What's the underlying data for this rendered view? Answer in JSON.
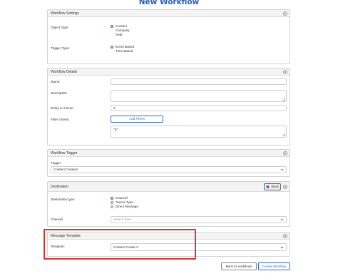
{
  "page": {
    "title": "New Workflow"
  },
  "workflow_settings": {
    "title": "Workflow Settings",
    "object_type_label": "Object Type:",
    "object_types": [
      "Contact",
      "Company",
      "Deal"
    ],
    "object_type_selected": "Contact",
    "trigger_type_label": "Trigger Type:",
    "trigger_types": [
      "Event Based",
      "Time Based"
    ],
    "trigger_type_selected": "Event Based"
  },
  "workflow_details": {
    "title": "Workflow Details",
    "name_label": "Name:",
    "name_value": "",
    "description_label": "Description",
    "description_value": "",
    "delay_label": "Delay in minute",
    "delay_value": "0",
    "filter_label": "Filter criteria",
    "add_filters_label": "Add Filters",
    "filter_value": "\"{}\""
  },
  "workflow_trigger": {
    "title": "Workflow Trigger",
    "trigger_label": "Trigger",
    "trigger_value": "Contact Creation"
  },
  "destination": {
    "title": "Destination",
    "slack_button": "Slack",
    "destination_type_label": "Destination type:",
    "destination_types": [
      "Channel",
      "Owner Type",
      "Direct Message"
    ],
    "destination_type_selected": "Channel",
    "channel_label": "Channel",
    "channel_placeholder": "Search here"
  },
  "message_template": {
    "title": "Message Template",
    "template_label": "Template:",
    "template_value": "Contact Create 2"
  },
  "footer": {
    "back_label": "Back to workflows",
    "create_label": "Create Workflow"
  },
  "colors": {
    "accent": "#2b6fd6",
    "title": "#2b5fb8",
    "highlight": "#e0322e"
  }
}
